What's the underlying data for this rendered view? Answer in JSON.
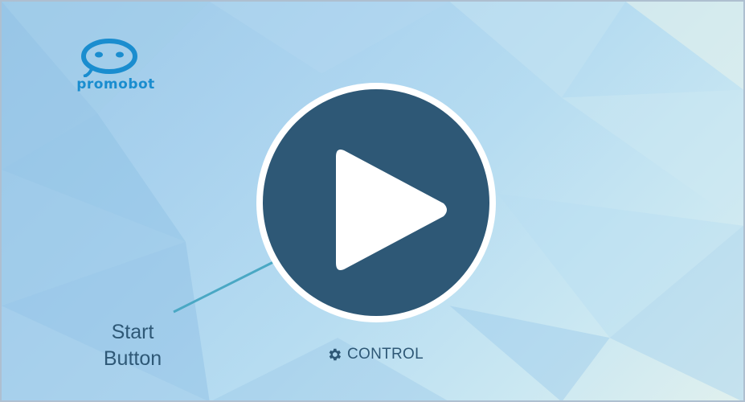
{
  "logo": {
    "text": "promobot"
  },
  "start_button": {
    "icon": "play-icon",
    "color": "#2e5876",
    "ring_color": "#ffffff"
  },
  "callout": {
    "line1": "Start",
    "line2": "Button",
    "line_color": "#4aa8c4"
  },
  "control": {
    "label": "CONTROL",
    "icon": "gear-icon"
  },
  "colors": {
    "accent": "#2e5876",
    "logo": "#1a8dcf"
  }
}
